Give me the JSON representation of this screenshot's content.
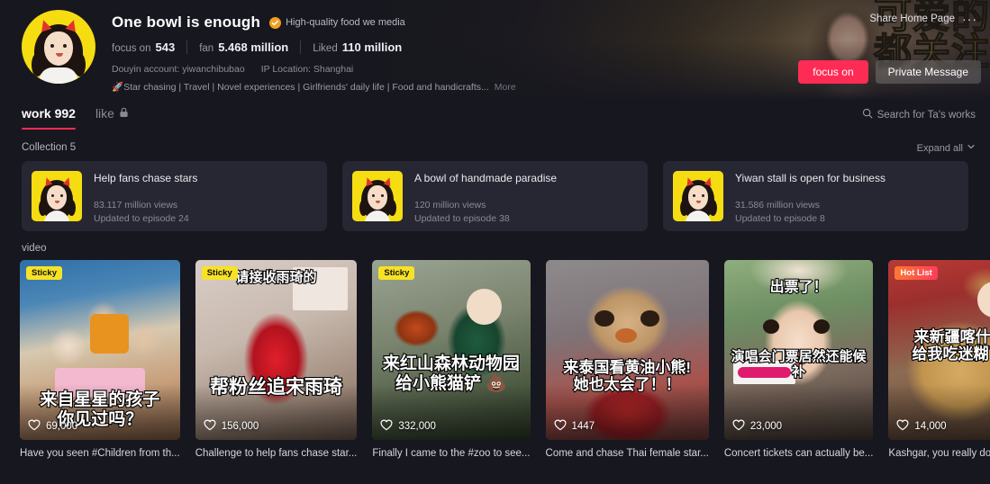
{
  "profile": {
    "name": "One bowl is enough",
    "verified_text": "High-quality food we media",
    "stats": [
      {
        "label": "focus on",
        "value": "543"
      },
      {
        "label": "fan",
        "value": "5.468 million"
      },
      {
        "label": "Liked",
        "value": "110 million"
      }
    ],
    "account_line": "Douyin account: yiwanchibubao",
    "ip_line": "IP Location: Shanghai",
    "tags": "🚀Star chasing | Travel | Novel experiences | Girlfriends' daily life | Food and handicrafts...",
    "more": "More"
  },
  "header": {
    "share_home": "Share Home Page",
    "more_dots": "···",
    "follow_button": "focus on",
    "message_button": "Private Message",
    "banner_overlay_text": "可爱的\n都关注",
    "accent_color": "#fe2c55"
  },
  "tabs": {
    "items": [
      {
        "label": "work 992",
        "active": true,
        "locked": false
      },
      {
        "label": "like",
        "active": false,
        "locked": true
      }
    ],
    "search_placeholder": "Search for Ta's works"
  },
  "collections": {
    "title": "Collection 5",
    "expand_all": "Expand all",
    "cards": [
      {
        "name": "Help fans chase stars",
        "views": "83.117 million views",
        "updated": "Updated to episode 24"
      },
      {
        "name": "A bowl of handmade paradise",
        "views": "120 million views",
        "updated": "Updated to episode 38"
      },
      {
        "name": "Yiwan stall is open for business",
        "views": "31.586 million views",
        "updated": "Updated to episode 8"
      }
    ]
  },
  "videos": {
    "section_label": "video",
    "items": [
      {
        "badge": "Sticky",
        "badge_type": "sticky",
        "likes": "69,000",
        "caption": "Have you seen #Children from th...",
        "overlay_text": "来自星星的孩子\n你见过吗？"
      },
      {
        "badge": "Sticky",
        "badge_type": "sticky",
        "likes": "156,000",
        "caption": "Challenge to help fans chase star...",
        "overlay_text": "请接收雨琦的\n帮粉丝追宋雨琦"
      },
      {
        "badge": "Sticky",
        "badge_type": "sticky",
        "likes": "332,000",
        "caption": "Finally I came to the #zoo to see...",
        "overlay_text": "来红山森林动物园\n给小熊猫铲 💩"
      },
      {
        "badge": "",
        "badge_type": "none",
        "likes": "1447",
        "caption": "Come and chase Thai female star...",
        "overlay_text": "来泰国看黄油小熊!\n她也太会了！！"
      },
      {
        "badge": "",
        "badge_type": "none",
        "likes": "23,000",
        "caption": "Concert tickets can actually be...",
        "overlay_text": "出票了！\n演唱会门票居然还能候补"
      },
      {
        "badge": "Hot List",
        "badge_type": "hot",
        "likes": "14,000",
        "caption": "Kashgar, you really don't want to...",
        "overlay_text": "来新疆喀什啦！\n给我吃迷糊了😋"
      }
    ]
  }
}
